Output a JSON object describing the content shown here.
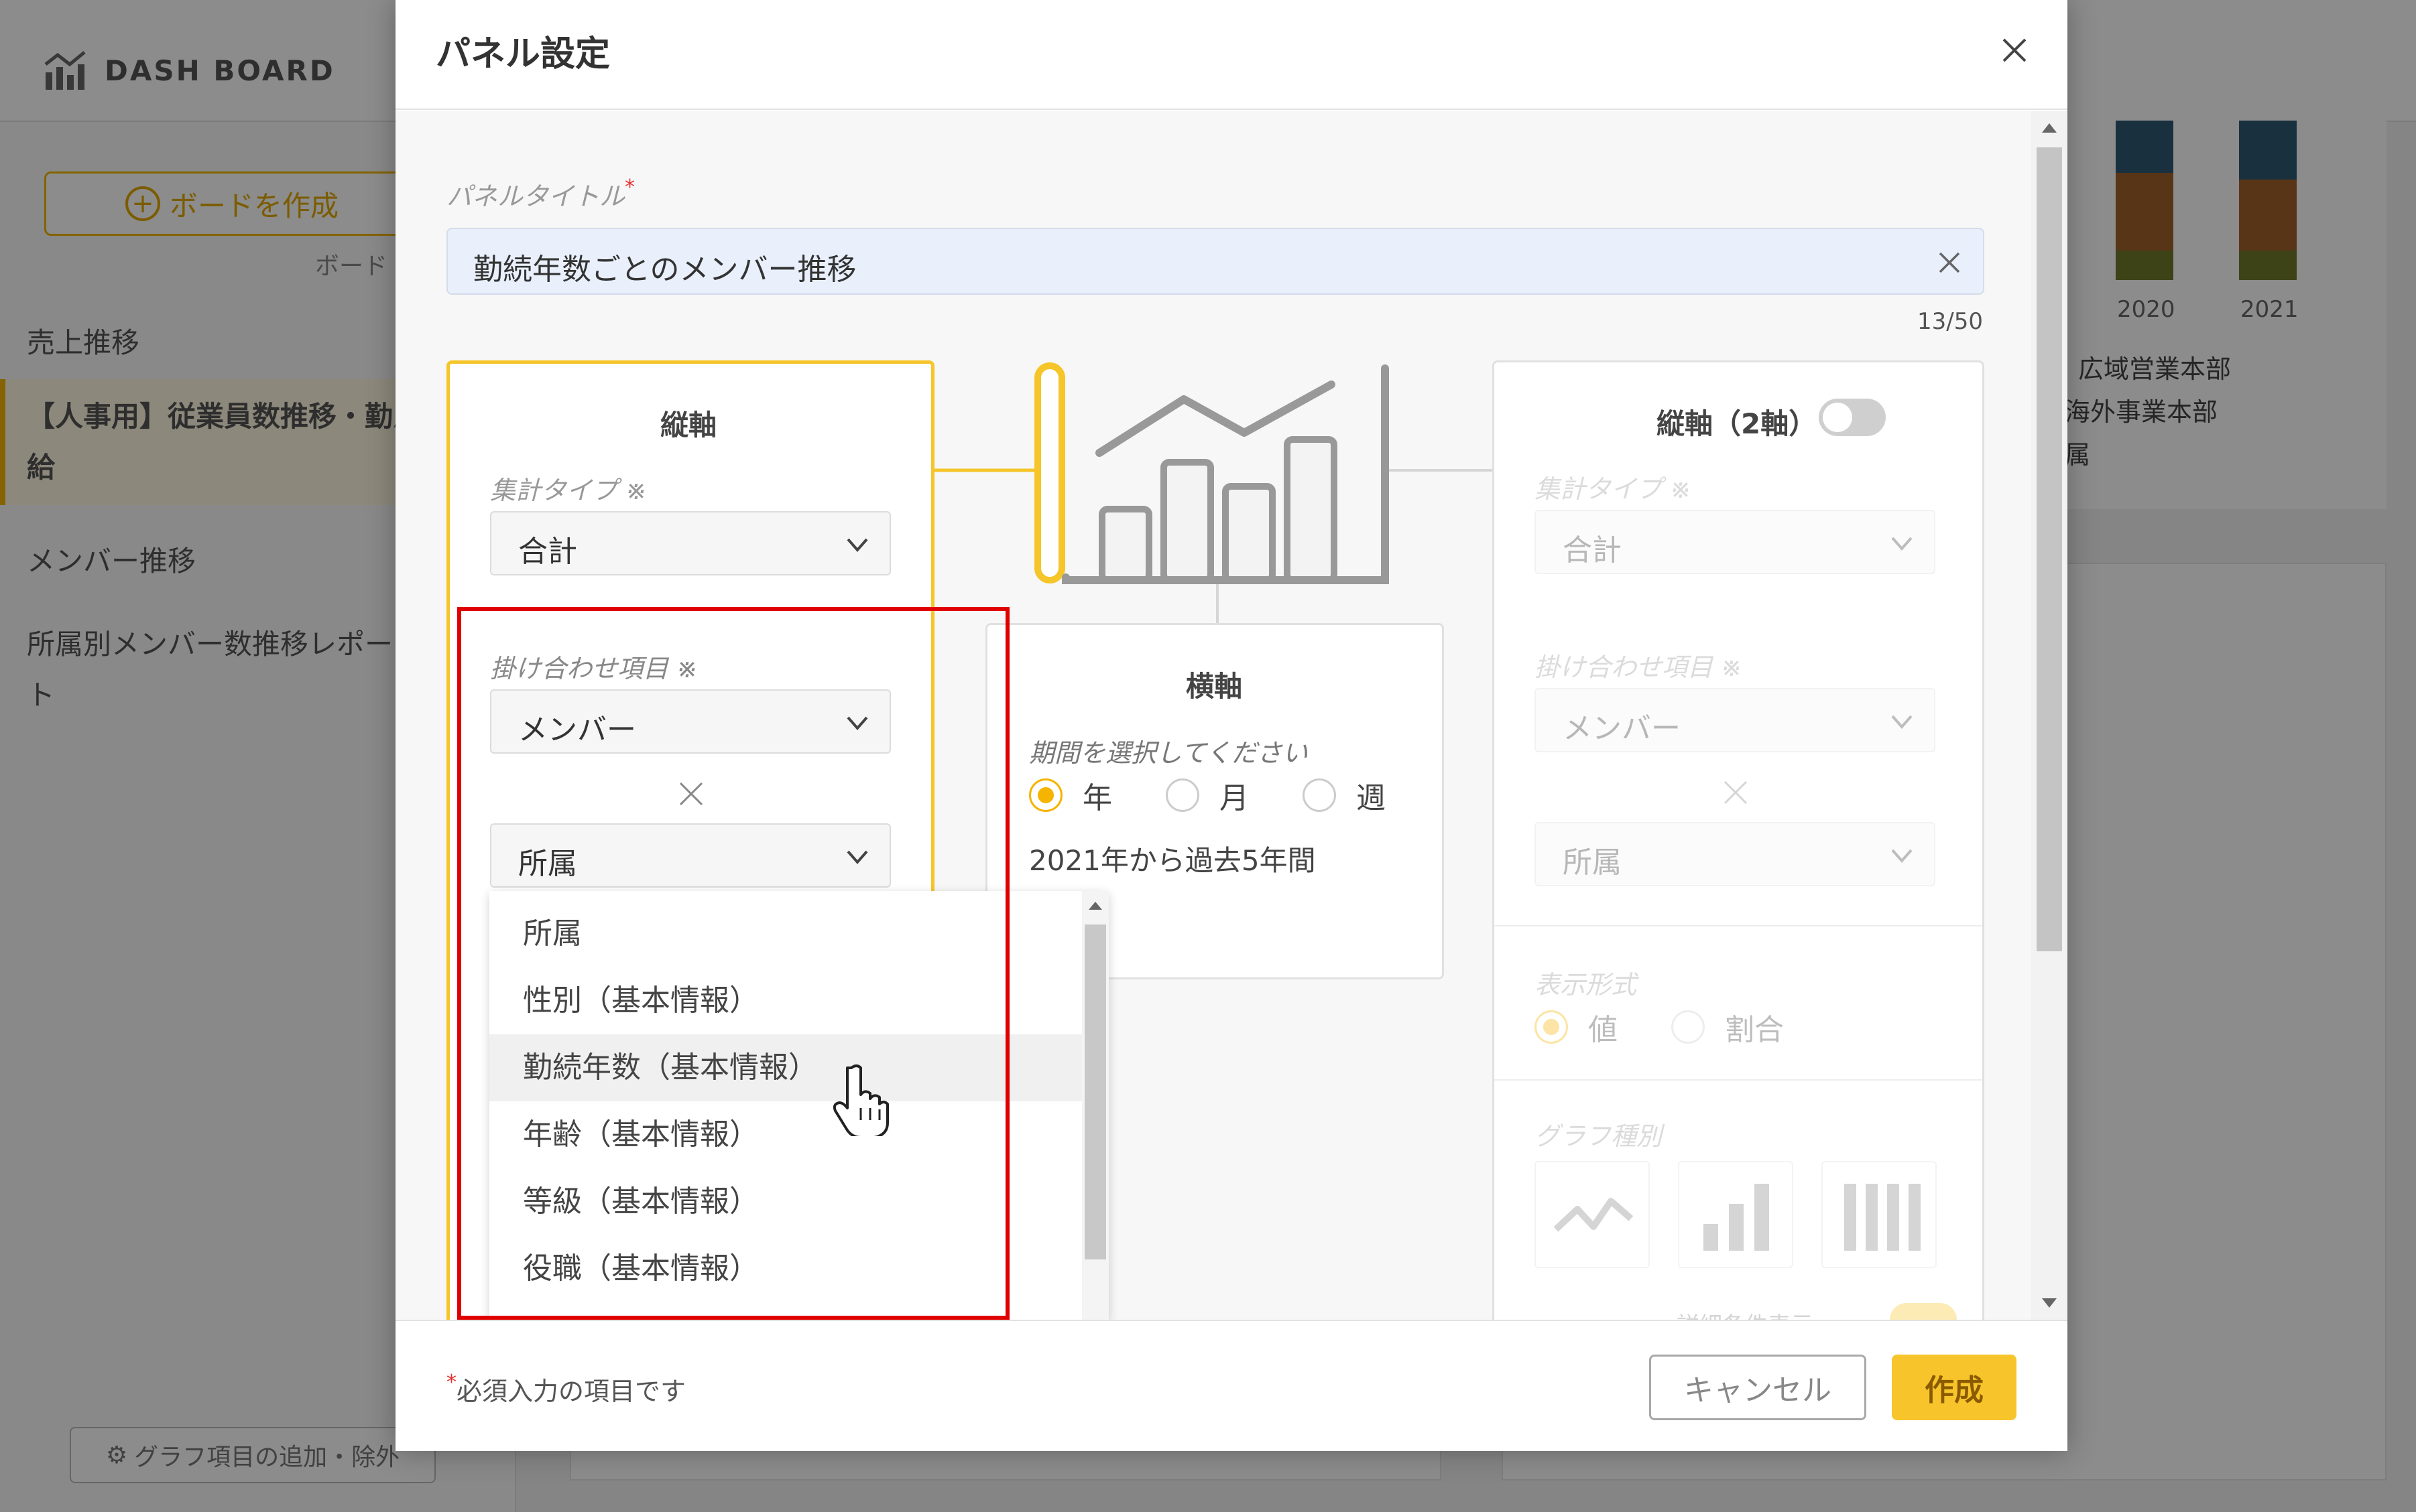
{
  "background": {
    "app_name": "DASH BOARD",
    "create_board_label": "ボードを作成",
    "board_hint": "ボード",
    "nav_items": [
      "売上推移",
      "【人事用】従業員数推移・勤怠・有給",
      "メンバー推移",
      "所属別メンバー数推移レポート"
    ],
    "graph_items_button": "グラフ項目の追加・除外",
    "chart_years": [
      "2020",
      "2021"
    ],
    "legend_depts": [
      "広域営業本部",
      "海外事業本部",
      "属"
    ],
    "chart_colors": [
      "#2e5a73",
      "#a0612a",
      "#6f7a2a"
    ]
  },
  "modal": {
    "title": "パネル設定",
    "panel_title_label": "パネルタイトル",
    "required_mark": "*",
    "panel_title_value": "勤続年数ごとのメンバー推移",
    "char_count": "13/50",
    "vertical_axis": {
      "title": "縦軸",
      "agg_type_label": "集計タイプ ※",
      "agg_type_value": "合計",
      "combo_label": "掛け合わせ項目 ※",
      "combo_value_1": "メンバー",
      "combo_value_2": "所属",
      "dropdown_options": [
        "所属",
        "性別（基本情報）",
        "勤続年数（基本情報）",
        "年齢（基本情報）",
        "等級（基本情報）",
        "役職（基本情報）"
      ],
      "hovered_option": "勤続年数（基本情報）"
    },
    "horizontal_axis": {
      "title": "横軸",
      "period_label": "期間を選択してください",
      "period_options": [
        "年",
        "月",
        "週"
      ],
      "selected_period": "年",
      "period_summary": "2021年から過去5年間"
    },
    "secondary_axis": {
      "title": "縦軸（2軸）",
      "enabled": false,
      "agg_type_label": "集計タイプ ※",
      "agg_type_value": "合計",
      "combo_label": "掛け合わせ項目 ※",
      "combo_value_1": "メンバー",
      "combo_value_2": "所属",
      "display_format_label": "表示形式",
      "display_options": [
        "値",
        "割合"
      ],
      "selected_display": "値",
      "graph_type_label": "グラフ種別",
      "detail_label": "詳細条件表示"
    },
    "footer": {
      "required_note": "必須入力の項目です",
      "cancel_label": "キャンセル",
      "create_label": "作成"
    },
    "accent_color": "#f5c52a",
    "highlight_color": "#e00000"
  }
}
